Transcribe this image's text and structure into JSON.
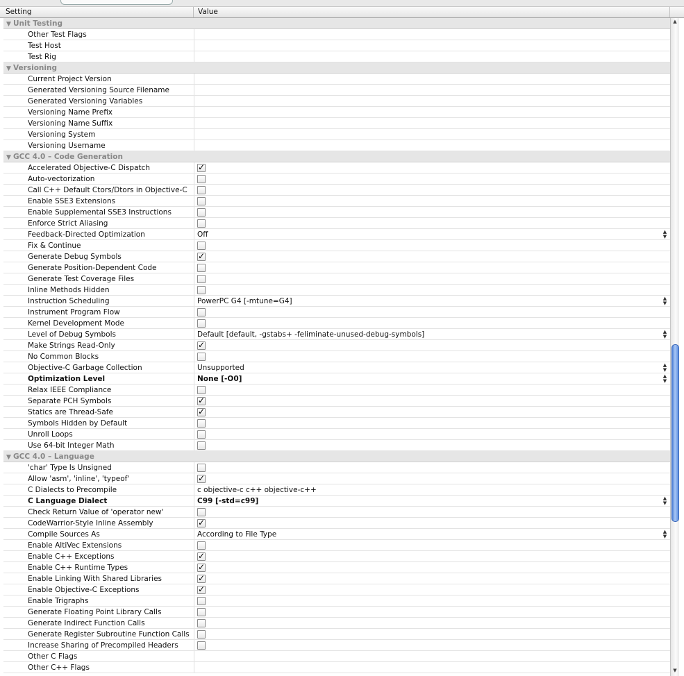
{
  "header": {
    "setting": "Setting",
    "value": "Value"
  },
  "rows": [
    {
      "group": "Unit Testing"
    },
    {
      "name": "Other Test Flags",
      "value": ""
    },
    {
      "name": "Test Host",
      "value": ""
    },
    {
      "name": "Test Rig",
      "value": ""
    },
    {
      "group": "Versioning"
    },
    {
      "name": "Current Project Version",
      "value": ""
    },
    {
      "name": "Generated Versioning Source Filename",
      "value": ""
    },
    {
      "name": "Generated Versioning Variables",
      "value": ""
    },
    {
      "name": "Versioning Name Prefix",
      "value": ""
    },
    {
      "name": "Versioning Name Suffix",
      "value": ""
    },
    {
      "name": "Versioning System",
      "value": ""
    },
    {
      "name": "Versioning Username",
      "value": ""
    },
    {
      "group": "GCC 4.0 – Code Generation"
    },
    {
      "name": "Accelerated Objective-C Dispatch",
      "checkbox": true
    },
    {
      "name": "Auto-vectorization",
      "checkbox": false
    },
    {
      "name": "Call C++ Default Ctors/Dtors in Objective-C",
      "checkbox": false
    },
    {
      "name": "Enable SSE3 Extensions",
      "checkbox": false
    },
    {
      "name": "Enable Supplemental SSE3 Instructions",
      "checkbox": false
    },
    {
      "name": "Enforce Strict Aliasing",
      "checkbox": false
    },
    {
      "name": "Feedback-Directed Optimization",
      "value": "Off",
      "popup": true
    },
    {
      "name": "Fix & Continue",
      "checkbox": false
    },
    {
      "name": "Generate Debug Symbols",
      "checkbox": true
    },
    {
      "name": "Generate Position-Dependent Code",
      "checkbox": false
    },
    {
      "name": "Generate Test Coverage Files",
      "checkbox": false
    },
    {
      "name": "Inline Methods Hidden",
      "checkbox": false
    },
    {
      "name": "Instruction Scheduling",
      "value": "PowerPC G4 [-mtune=G4]",
      "popup": true
    },
    {
      "name": "Instrument Program Flow",
      "checkbox": false
    },
    {
      "name": "Kernel Development Mode",
      "checkbox": false
    },
    {
      "name": "Level of Debug Symbols",
      "value": "Default [default, -gstabs+ -feliminate-unused-debug-symbols]",
      "popup": true
    },
    {
      "name": "Make Strings Read-Only",
      "checkbox": true
    },
    {
      "name": "No Common Blocks",
      "checkbox": false
    },
    {
      "name": "Objective-C Garbage Collection",
      "value": "Unsupported",
      "popup": true
    },
    {
      "name": "Optimization Level",
      "value": "None [-O0]",
      "popup": true,
      "bold": true
    },
    {
      "name": "Relax IEEE Compliance",
      "checkbox": false
    },
    {
      "name": "Separate PCH Symbols",
      "checkbox": true
    },
    {
      "name": "Statics are Thread-Safe",
      "checkbox": true
    },
    {
      "name": "Symbols Hidden by Default",
      "checkbox": false
    },
    {
      "name": "Unroll Loops",
      "checkbox": false
    },
    {
      "name": "Use 64-bit Integer Math",
      "checkbox": false
    },
    {
      "group": "GCC 4.0 – Language"
    },
    {
      "name": "'char' Type Is Unsigned",
      "checkbox": false
    },
    {
      "name": "Allow 'asm', 'inline', 'typeof'",
      "checkbox": true
    },
    {
      "name": "C Dialects to Precompile",
      "value": "c objective-c c++ objective-c++"
    },
    {
      "name": "C Language Dialect",
      "value": "C99 [-std=c99]",
      "popup": true,
      "bold": true
    },
    {
      "name": "Check Return Value of 'operator new'",
      "checkbox": false
    },
    {
      "name": "CodeWarrior-Style Inline Assembly",
      "checkbox": true
    },
    {
      "name": "Compile Sources As",
      "value": "According to File Type",
      "popup": true
    },
    {
      "name": "Enable AltiVec Extensions",
      "checkbox": false
    },
    {
      "name": "Enable C++ Exceptions",
      "checkbox": true
    },
    {
      "name": "Enable C++ Runtime Types",
      "checkbox": true
    },
    {
      "name": "Enable Linking With Shared Libraries",
      "checkbox": true
    },
    {
      "name": "Enable Objective-C Exceptions",
      "checkbox": true
    },
    {
      "name": "Enable Trigraphs",
      "checkbox": false
    },
    {
      "name": "Generate Floating Point Library Calls",
      "checkbox": false
    },
    {
      "name": "Generate Indirect Function Calls",
      "checkbox": false
    },
    {
      "name": "Generate Register Subroutine Function Calls",
      "checkbox": false
    },
    {
      "name": "Increase Sharing of Precompiled Headers",
      "checkbox": false
    },
    {
      "name": "Other C Flags",
      "value": ""
    },
    {
      "name": "Other C++ Flags",
      "value": ""
    }
  ],
  "icons": {
    "disclosure": "disclosure-triangle-icon",
    "stepper": "popup-stepper-icon",
    "scroll_up": "scroll-up-arrow-icon",
    "scroll_down": "scroll-down-arrow-icon"
  },
  "colors": {
    "group_bg": "#e6e6e6",
    "group_text": "#888888",
    "scroll_thumb": "#5f91e2"
  }
}
